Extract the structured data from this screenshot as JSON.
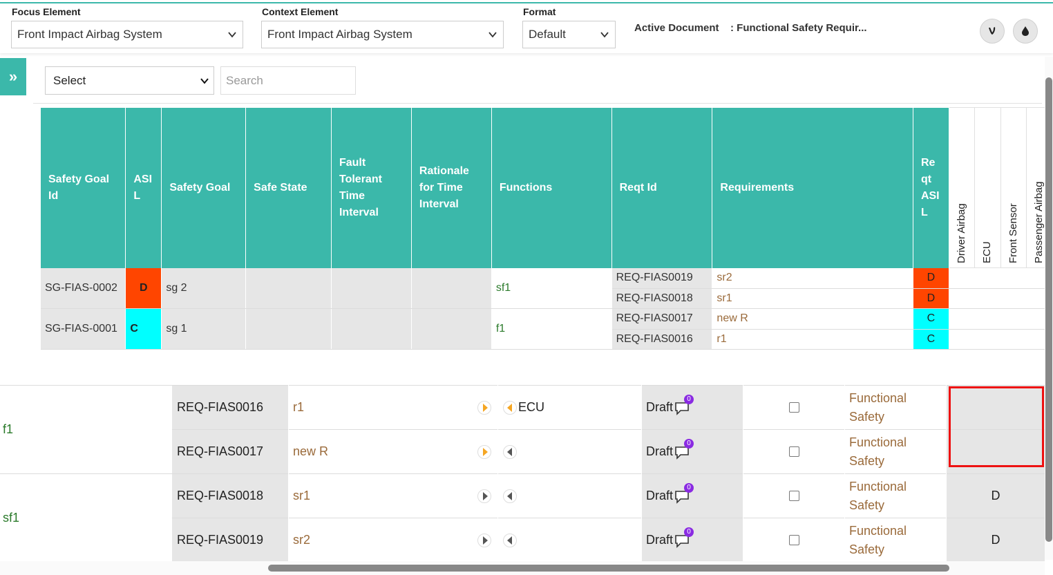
{
  "header": {
    "focus_label": "Focus Element",
    "focus_value": "Front Impact Airbag System",
    "context_label": "Context Element",
    "context_value": "Front Impact Airbag System",
    "format_label": "Format",
    "format_value": "Default",
    "active_doc_label": "Active Document",
    "active_doc_value": ": Functional Safety Requir..."
  },
  "toolbar": {
    "select_value": "Select",
    "search_placeholder": "Search",
    "toggle_icon": "»"
  },
  "matrix": {
    "columns": [
      "Safety Goal Id",
      "ASI L",
      "Safety Goal",
      "Safe State",
      "Fault Tolerant Time Interval",
      "Rationale for Time Interval",
      "Functions",
      "Reqt Id",
      "Requirements",
      "Re qt ASI L"
    ],
    "vertical_columns": [
      "Driver Airbag",
      "ECU",
      "Front Sensor",
      "Passenger Airbag"
    ],
    "groups": [
      {
        "goal_id": "SG-FIAS-0002",
        "asil": "D",
        "asil_color": "#ff4500",
        "goal": "sg 2",
        "function": "sf1",
        "rows": [
          {
            "reqt_id": "REQ-FIAS0019",
            "req": "sr2",
            "reqt_asil": "D"
          },
          {
            "reqt_id": "REQ-FIAS0018",
            "req": "sr1",
            "reqt_asil": "D"
          }
        ]
      },
      {
        "goal_id": "SG-FIAS-0001",
        "asil": "C",
        "asil_color": "#00ffff",
        "goal": "sg 1",
        "function": "f1",
        "rows": [
          {
            "reqt_id": "REQ-FIAS0017",
            "req": "new R",
            "reqt_asil": "C"
          },
          {
            "reqt_id": "REQ-FIAS0016",
            "req": "r1",
            "reqt_asil": "C"
          }
        ]
      }
    ]
  },
  "lower": {
    "groups": [
      {
        "label": "f1"
      },
      {
        "label": "sf1"
      }
    ],
    "rows": [
      {
        "id": "REQ-FIAS0016",
        "req": "r1",
        "alloc": "ECU",
        "status": "Draft",
        "count": "0",
        "category": "Functional Safety",
        "asil": ""
      },
      {
        "id": "REQ-FIAS0017",
        "req": "new R",
        "alloc": "",
        "status": "Draft",
        "count": "0",
        "category": "Functional Safety",
        "asil": ""
      },
      {
        "id": "REQ-FIAS0018",
        "req": "sr1",
        "alloc": "",
        "status": "Draft",
        "count": "0",
        "category": "Functional Safety",
        "asil": "D"
      },
      {
        "id": "REQ-FIAS0019",
        "req": "sr2",
        "alloc": "",
        "status": "Draft",
        "count": "0",
        "category": "Functional Safety",
        "asil": "D"
      }
    ]
  },
  "colors": {
    "accent": "#3bb8aa",
    "asil_d": "#ff4500",
    "asil_c": "#00ffff",
    "badge": "#8a2be2",
    "highlight": "#ee1111"
  },
  "icons": [
    "chevron-down-icon",
    "double-chevron-right-icon",
    "flame-icon",
    "drop-icon",
    "chat-bubble-icon",
    "arrow-right-icon",
    "arrow-left-icon"
  ]
}
